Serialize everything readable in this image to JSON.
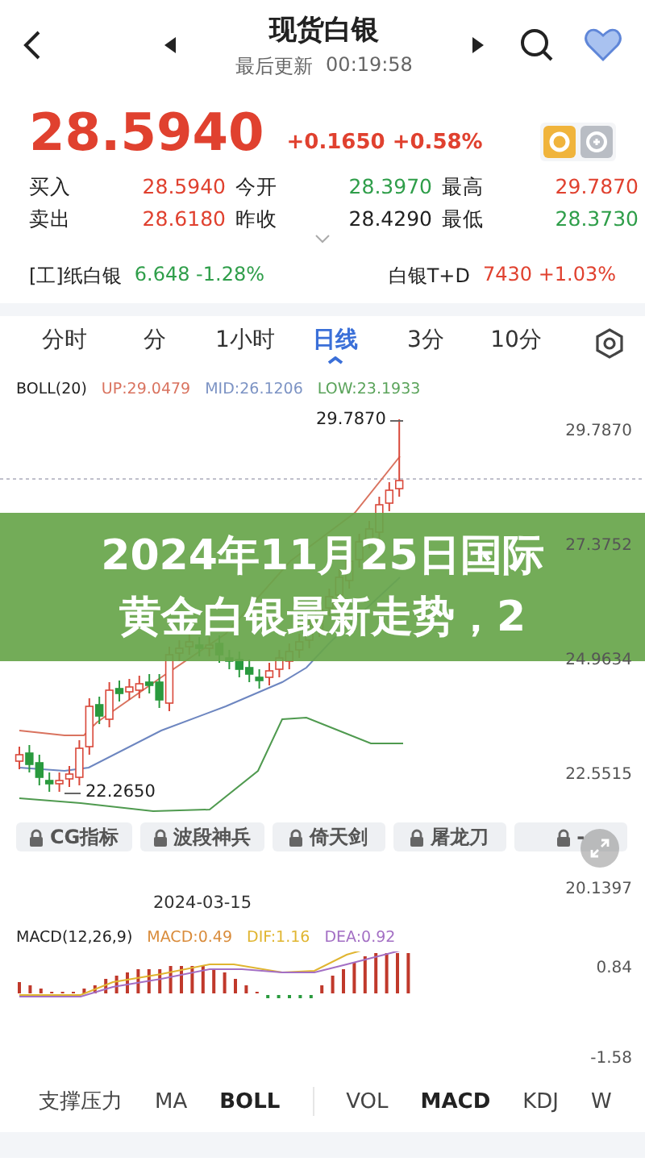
{
  "header": {
    "title": "现货白银",
    "update_label": "最后更新",
    "update_time": "00:19:58"
  },
  "quote": {
    "price": "28.5940",
    "change": "+0.1650 +0.58%",
    "color": "#e0412f"
  },
  "stats": [
    {
      "label": "买入",
      "value": "28.5940",
      "color": "#e0412f"
    },
    {
      "label": "今开",
      "value": "28.3970",
      "color": "#2f9e4a"
    },
    {
      "label": "最高",
      "value": "29.7870",
      "color": "#e0412f"
    },
    {
      "label": "卖出",
      "value": "28.6180",
      "color": "#e0412f"
    },
    {
      "label": "昨收",
      "value": "28.4290",
      "color": "#222222"
    },
    {
      "label": "最低",
      "value": "28.3730",
      "color": "#2f9e4a"
    }
  ],
  "related": [
    {
      "name": "[工]纸白银",
      "value": "6.648 -1.28%",
      "color": "#2f9e4a"
    },
    {
      "name": "白银T+D",
      "value": "7430 +1.03%",
      "color": "#e0412f"
    }
  ],
  "period_tabs": [
    {
      "label": "分时",
      "selected": false
    },
    {
      "label": "分",
      "selected": false
    },
    {
      "label": "1小时",
      "selected": false
    },
    {
      "label": "日线",
      "selected": true
    },
    {
      "label": "3分",
      "selected": false
    },
    {
      "label": "10分",
      "selected": false
    }
  ],
  "boll_legend": {
    "name": "BOLL(20)",
    "up": "UP:29.0479",
    "mid": "MID:26.1206",
    "low": "LOW:23.1933"
  },
  "price_axis": [
    "29.7870",
    "27.3752",
    "24.9634",
    "22.5515",
    "20.1397"
  ],
  "max_label": "29.7870",
  "min_label": "22.2650",
  "indicator_chips": [
    {
      "label": "CG指标",
      "locked": true
    },
    {
      "label": "波段神兵",
      "locked": true
    },
    {
      "label": "倚天剑",
      "locked": true
    },
    {
      "label": "屠龙刀",
      "locked": true
    },
    {
      "label": "-",
      "locked": true
    }
  ],
  "date_label": "2024-03-15",
  "macd_legend": {
    "name": "MACD(12,26,9)",
    "macd": "MACD:0.49",
    "dif": "DIF:1.16",
    "dea": "DEA:0.92"
  },
  "macd_axis": [
    "0.84",
    "-1.58"
  ],
  "indicator_tabs": [
    [
      {
        "label": "支撑压力",
        "selected": false
      },
      {
        "label": "MA",
        "selected": false
      },
      {
        "label": "BOLL",
        "selected": true
      }
    ],
    [
      {
        "label": "VOL",
        "selected": false
      },
      {
        "label": "MACD",
        "selected": true
      },
      {
        "label": "KDJ",
        "selected": false
      },
      {
        "label": "W",
        "selected": false
      }
    ]
  ],
  "banner": {
    "lines": [
      "2024年11月25日国际",
      "黄金白银最新走势，2"
    ]
  }
}
